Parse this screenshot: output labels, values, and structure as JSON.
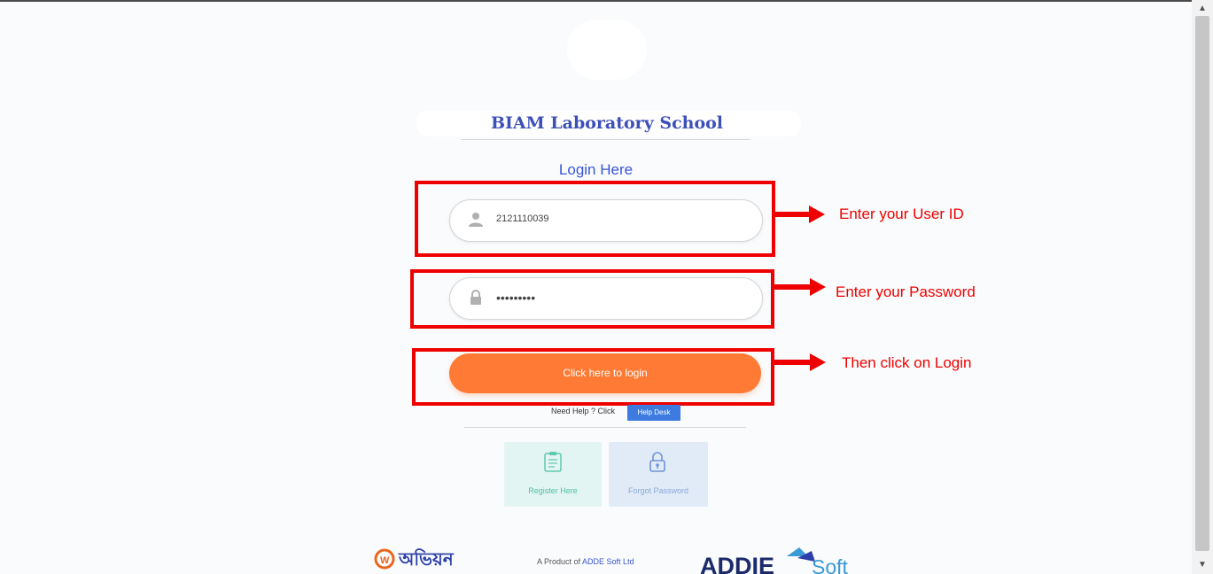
{
  "header": {
    "school_name": "BIAM Laboratory School"
  },
  "login": {
    "heading": "Login Here",
    "user_id_value": "2121110039",
    "password_value": "•••••••••",
    "login_button": "Click here to login"
  },
  "annotations": {
    "user_id": "Enter your User ID",
    "password": "Enter your Password",
    "login": "Then click on Login"
  },
  "help": {
    "text": "Need Help ? Click",
    "help_desk_button": "Help Desk"
  },
  "cards": {
    "register_label": "Register Here",
    "forgot_label": "Forgot Password"
  },
  "footer": {
    "prefix": "A Product of ",
    "company": "ADDE Soft Ltd",
    "brand_left_text": "অভিয়ন",
    "brand_right_text": "ADDIE",
    "brand_right_suffix": "Soft"
  },
  "colors": {
    "accent_red": "#ee0000",
    "login_orange": "#ff7a34",
    "title_blue": "#3d4fb8",
    "help_blue": "#3d7be0"
  },
  "icons": {
    "user": "user-icon",
    "password": "lock-icon",
    "register": "clipboard-icon",
    "forgot": "padlock-icon"
  }
}
